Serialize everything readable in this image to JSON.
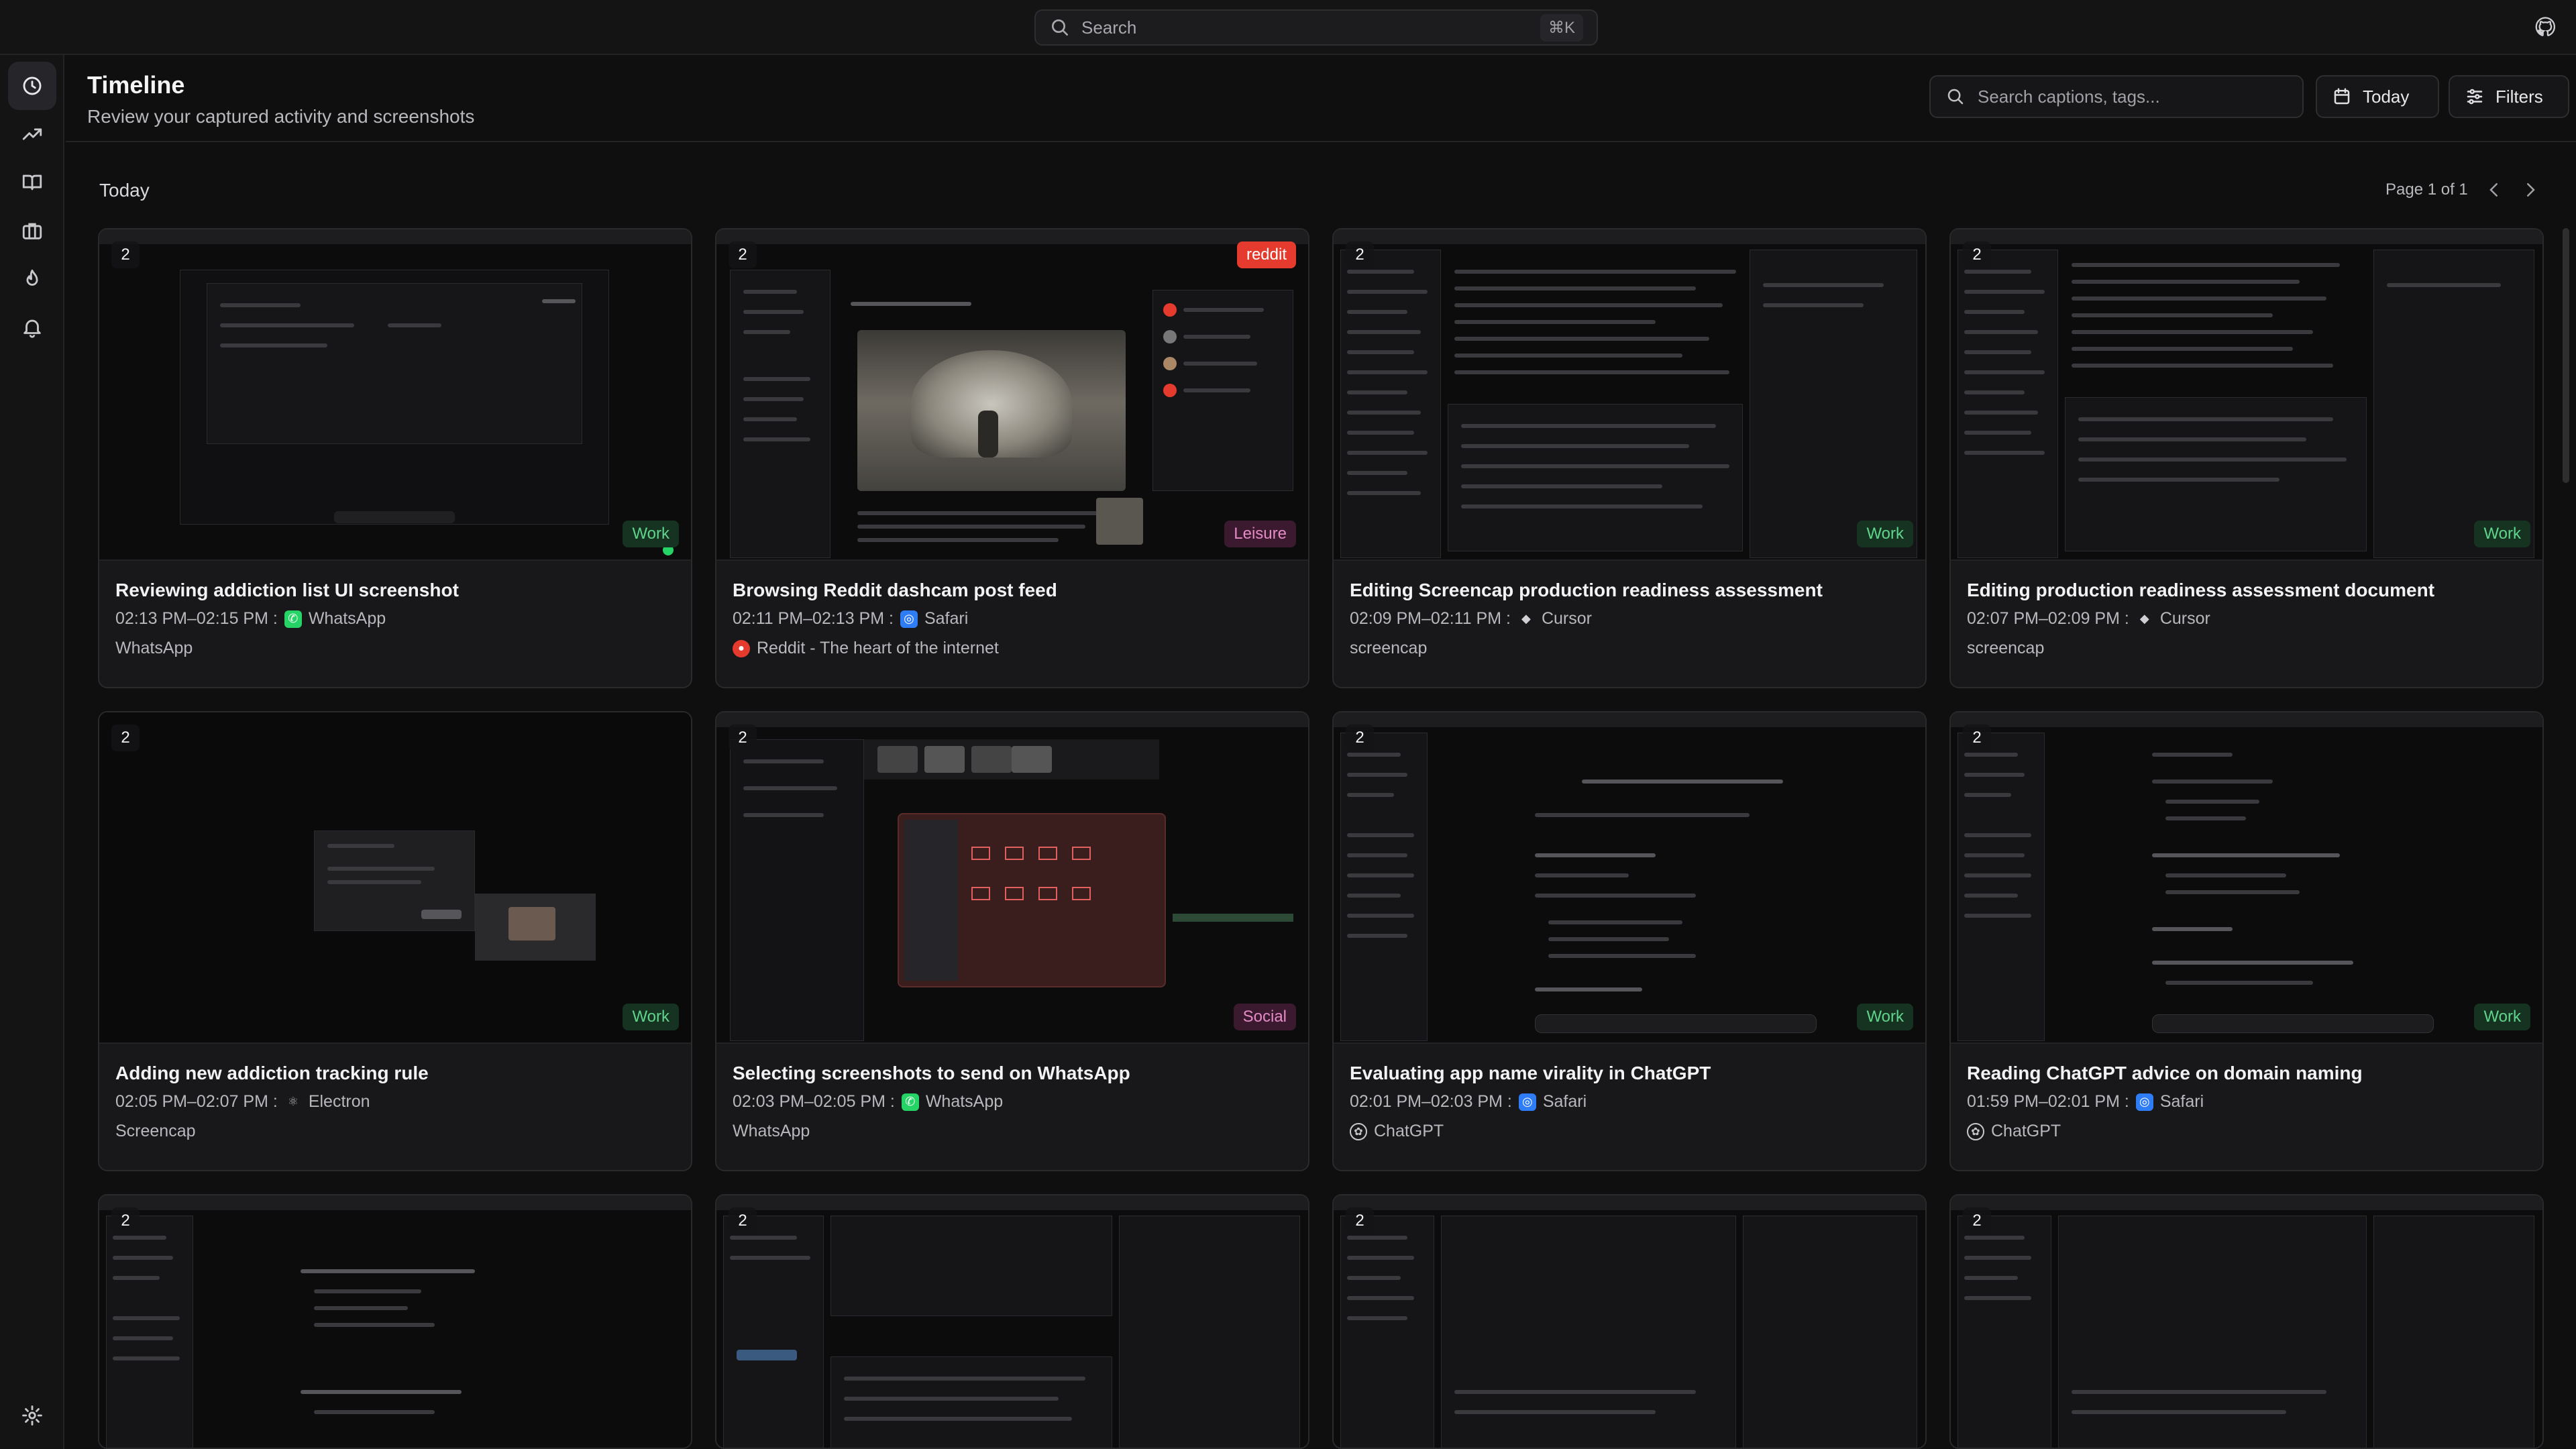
{
  "topbar": {
    "search_placeholder": "Search",
    "shortcut": "⌘K"
  },
  "header": {
    "title": "Timeline",
    "subtitle": "Review your captured activity and screenshots",
    "caption_search_placeholder": "Search captions, tags...",
    "today_label": "Today",
    "filters_label": "Filters"
  },
  "timeline": {
    "day_label": "Today",
    "page_label": "Page 1 of 1"
  },
  "cards": [
    {
      "count": "2",
      "category": "Work",
      "title": "Reviewing addiction list UI screenshot",
      "time": "02:13 PM–02:15 PM :",
      "app": "WhatsApp",
      "tag": "WhatsApp"
    },
    {
      "count": "2",
      "category": "Leisure",
      "site": "reddit",
      "title": "Browsing Reddit dashcam post feed",
      "time": "02:11 PM–02:13 PM :",
      "app": "Safari",
      "tag": "Reddit - The heart of the internet"
    },
    {
      "count": "2",
      "category": "Work",
      "title": "Editing Screencap production readiness assessment",
      "time": "02:09 PM–02:11 PM :",
      "app": "Cursor",
      "tag": "screencap"
    },
    {
      "count": "2",
      "category": "Work",
      "title": "Editing production readiness assessment document",
      "time": "02:07 PM–02:09 PM :",
      "app": "Cursor",
      "tag": "screencap"
    },
    {
      "count": "2",
      "category": "Work",
      "title": "Adding new addiction tracking rule",
      "time": "02:05 PM–02:07 PM :",
      "app": "Electron",
      "tag": "Screencap"
    },
    {
      "count": "2",
      "category": "Social",
      "title": "Selecting screenshots to send on WhatsApp",
      "time": "02:03 PM–02:05 PM :",
      "app": "WhatsApp",
      "tag": "WhatsApp"
    },
    {
      "count": "2",
      "category": "Work",
      "title": "Evaluating app name virality in ChatGPT",
      "time": "02:01 PM–02:03 PM :",
      "app": "Safari",
      "tag": "ChatGPT"
    },
    {
      "count": "2",
      "category": "Work",
      "title": "Reading ChatGPT advice on domain naming",
      "time": "01:59 PM–02:01 PM :",
      "app": "Safari",
      "tag": "ChatGPT"
    },
    {
      "count": "2"
    },
    {
      "count": "2"
    },
    {
      "count": "2"
    },
    {
      "count": "2"
    }
  ],
  "colors": {
    "work_badge": "#5fd48a",
    "leisure_badge": "#e58bc6",
    "reddit_badge": "#e53b2f",
    "whatsapp": "#25d366",
    "safari": "#2f7df6"
  }
}
